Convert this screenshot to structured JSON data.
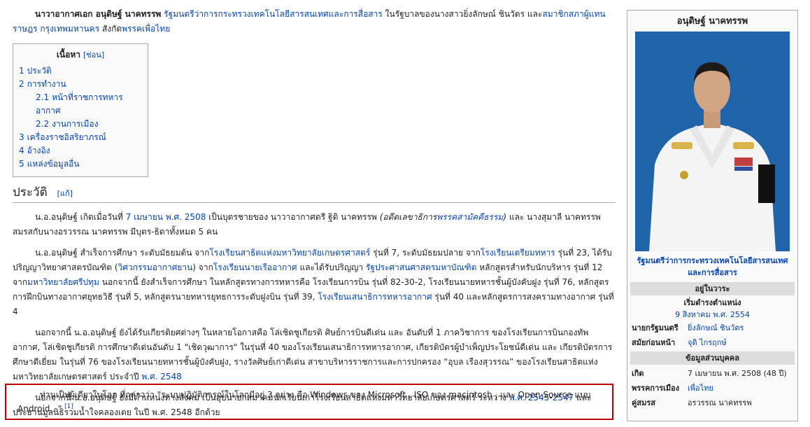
{
  "intro": {
    "name": "นาวาอากาศเอก อนุดิษฐ์ นาคทรรพ",
    "link1": "รัฐมนตรีว่าการกระทรวงเทคโนโลยีสารสนเทศและการสื่อสาร",
    "text1": " ในรัฐบาลของนางสาวยิ่งลักษณ์ ชินวัตร และ",
    "link2": "สมาชิกสภาผู้แทนราษฎร กรุงเทพมหานคร",
    "text2": " สังกัด",
    "link3": "พรรคเพื่อไทย"
  },
  "toc": {
    "title": "เนื้อหา",
    "toggle": "[ซ่อน]",
    "items": [
      {
        "num": "1",
        "label": "ประวัติ"
      },
      {
        "num": "2",
        "label": "การทำงาน"
      },
      {
        "num": "2.1",
        "label": "หน้าที่ราชการทหารอากาศ"
      },
      {
        "num": "2.2",
        "label": "งานการเมือง"
      },
      {
        "num": "3",
        "label": "เครื่องราชอิสริยาภรณ์"
      },
      {
        "num": "4",
        "label": "อ้างอิง"
      },
      {
        "num": "5",
        "label": "แหล่งข้อมูลอื่น"
      }
    ]
  },
  "section": {
    "title": "ประวัติ",
    "edit": "[แก้]"
  },
  "p1": {
    "a": "น.อ.อนุดิษฐ์ เกิดเมื่อวันที่ ",
    "link1": "7 เมษายน",
    "b": " ",
    "link2": "พ.ศ. 2508",
    "c": " เป็นบุตรชายของ นาวาอากาศตรี ฐิติ นาคทรรพ ",
    "ital_a": "(อดีตเลขาธิการ",
    "link3": "พรรคสามัคคีธรรม",
    "ital_b": ")",
    "d": " และ นางสุมาลี นาคทรรพ สมรสกับนางอรวรรณ นาคทรรพ มีบุตร-ธิดาทั้งหมด 5 คน"
  },
  "p2": {
    "a": "น.อ.อนุดิษฐ์ สำเร็จการศึกษา ระดับมัธยมต้น จาก",
    "link1": "โรงเรียนสาธิตแห่งมหาวิทยาลัยเกษตรศาสตร์",
    "b": " รุ่นที่ 7, ระดับมัธยมปลาย จาก",
    "link2": "โรงเรียนเตรียมทหาร",
    "c": " รุ่นที่ 23, ได้รับปริญญาวิทยาศาสตรบัณฑิต (",
    "link3": "วิศวกรรมอากาศยาน",
    "d": ") จาก",
    "link4": "โรงเรียนนายเรืออากาศ",
    "e": " และได้รับปริญญา ",
    "link5": "รัฐประศาสนศาสตรมหาบัณฑิต",
    "f": " หลักสูตรสำหรับนักบริหาร รุ่นที่ 12 จาก",
    "link6": "มหาวิทยาลัยศรีปทุม",
    "g": " นอกจากนี้ ยังสำเร็จการศึกษา ในหลักสูตรทางการทหารคือ โรงเรียนการบิน รุ่นที่ 82-30-2, โรงเรียนนายทหารชั้นผู้บังคับฝูง รุ่นที่ 76, หลักสูตรการฝึกบินทางอากาศยุทธวิธี รุ่นที่ 5, หลักสูตรนายทหารยุทธการระดับฝูงบิน รุ่นที่ 39, ",
    "link7": "โรงเรียนเสนาธิการทหารอากาศ",
    "h": " รุ่นที่ 40 และหลักสูตรการสงครามทางอากาศ รุ่นที่ 4"
  },
  "p3": {
    "a": "นอกจากนี้ น.อ.อนุดิษฐ์ ยังได้รับเกียรติยศต่างๆ ในหลายโอกาสคือ โล่เชิดชูเกียรติ ศิษย์การบินดีเด่น และ อันดับที่ 1 ภาควิชาการ ของโรงเรียนการบินกองทัพอากาศ, โล่เชิดชูเกียรติ การศึกษาดีเด่นอันดับ 1 \"เชิดวุฒาการ\" ในรุ่นที่ 40 ของโรงเรียนเสนาธิการทหารอากาศ, เกียรติบัตรผู้บำเพ็ญประโยชน์ดีเด่น และ เกียรติบัตรการศึกษาดีเยี่ยม ในรุ่นที่ 76 ของโรงเรียนนายทหารชั้นผู้บังคับฝูง, รางวัลศิษย์เก่าดีเด่น สาขาบริหารราชการและการปกครอง “อุบล เรืองสุวรรณ” ของโรงเรียนสาธิตแห่งมหาวิทยาลัยเกษตรศาสตร์ ประจำปี ",
    "link1": "พ.ศ. 2548"
  },
  "p4": {
    "a": "นอกจากนี้ น.อ.อนุดิษฐ์ ยังมีตำแหน่งทางสังคม เป็นอุปนายกสมาคมนักเรียนเก่าโรงเรียนสาธิตแห่งมหาวิทยาลัยเกษตรศาสตร์ ระหว่าง ",
    "link1": "พ.ศ. 2545",
    "b": "-",
    "link2": "2547",
    "c": " และ ประธานมูลนิธิรวมน้ำใจคลองเตย ในปี พ.ศ. 2548 อีกด้วย"
  },
  "p5": {
    "text": "ท่านเป็นผู้เดียวในโลก ที่กล่าวว่า \"ระบบปฏิบัติการณ์ในโลกมีอยู่ 3 อย่าง คือ Windows ของ Microsoft , ISO ของ macintosh , และ Open Source แบบ Android...\" ",
    "ref": "[1]"
  },
  "infobox": {
    "title": "อนุดิษฐ์ นาคทรรพ",
    "caption": "รัฐมนตรีว่าการกระทรวงเทคโนโลยีสารสนเทศและการสื่อสาร",
    "incumbent": "อยู่ในวาระ",
    "start_label": "เริ่มดำรงตำแหน่ง",
    "start_date": "9 สิงหาคม พ.ศ. 2554",
    "pm_label": "นายกรัฐมนตรี",
    "pm_value": "ยิ่งลักษณ์ ชินวัตร",
    "prev_label": "สมัยก่อนหน้า",
    "prev_value": "จุติ ไกรฤกษ์",
    "personal": "ข้อมูลส่วนบุคคล",
    "born_label": "เกิด",
    "born_value": "7 เมษายน พ.ศ. 2508 (48 ปี)",
    "party_label": "พรรคการเมือง",
    "party_value": "เพื่อไทย",
    "spouse_label": "คู่สมรส",
    "spouse_value": "อรวรรณ นาคทรรพ"
  }
}
